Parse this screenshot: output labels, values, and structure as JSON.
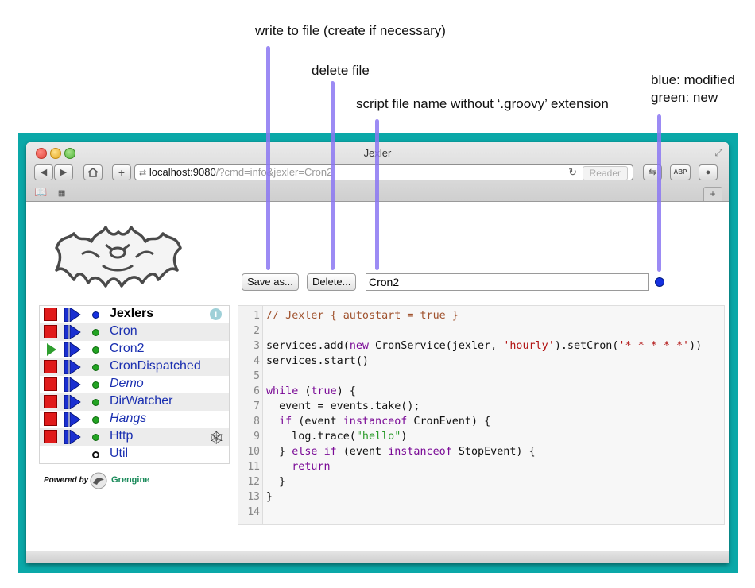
{
  "annotations": {
    "write": "write to file (create if necessary)",
    "delete": "delete file",
    "script_name": "script file name without ‘.groovy’ extension",
    "status_line1": "blue: modified",
    "status_line2": "green: new"
  },
  "window": {
    "title": "Jexler",
    "url_host": "localhost:9080",
    "url_path": "/?cmd=info&jexler=Cron2",
    "reader_label": "Reader"
  },
  "toolbar": {
    "save_label": "Save as...",
    "delete_label": "Delete...",
    "script_name_value": "Cron2",
    "status_color": "#1530e0"
  },
  "jexlers": [
    {
      "name": "Jexlers",
      "state": "stop",
      "dot": "blue",
      "style": "bold"
    },
    {
      "name": "Cron",
      "state": "stop",
      "dot": "green",
      "style": "normal"
    },
    {
      "name": "Cron2",
      "state": "play",
      "dot": "green",
      "style": "normal"
    },
    {
      "name": "CronDispatched",
      "state": "stop",
      "dot": "green",
      "style": "normal"
    },
    {
      "name": "Demo",
      "state": "stop",
      "dot": "green",
      "style": "italic"
    },
    {
      "name": "DirWatcher",
      "state": "stop",
      "dot": "green",
      "style": "normal"
    },
    {
      "name": "Hangs",
      "state": "stop",
      "dot": "green",
      "style": "italic"
    },
    {
      "name": "Http",
      "state": "stop",
      "dot": "green",
      "style": "normal"
    },
    {
      "name": "Util",
      "state": "none",
      "dot": "empty",
      "style": "normal"
    }
  ],
  "footer": {
    "powered_by": "Powered by",
    "brand": "Grengine"
  },
  "editor": {
    "line_numbers": [
      "1",
      "2",
      "3",
      "4",
      "5",
      "6",
      "7",
      "8",
      "9",
      "10",
      "11",
      "12",
      "13",
      "14"
    ],
    "code": [
      "// Jexler { autostart = true }",
      "",
      "services.add(new CronService(jexler, 'hourly').setCron('* * * * *'))",
      "services.start()",
      "",
      "while (true) {",
      "  event = events.take();",
      "  if (event instanceof CronEvent) {",
      "    log.trace(\"hello\")",
      "  } else if (event instanceof StopEvent) {",
      "    return",
      "  }",
      "}",
      ""
    ]
  }
}
